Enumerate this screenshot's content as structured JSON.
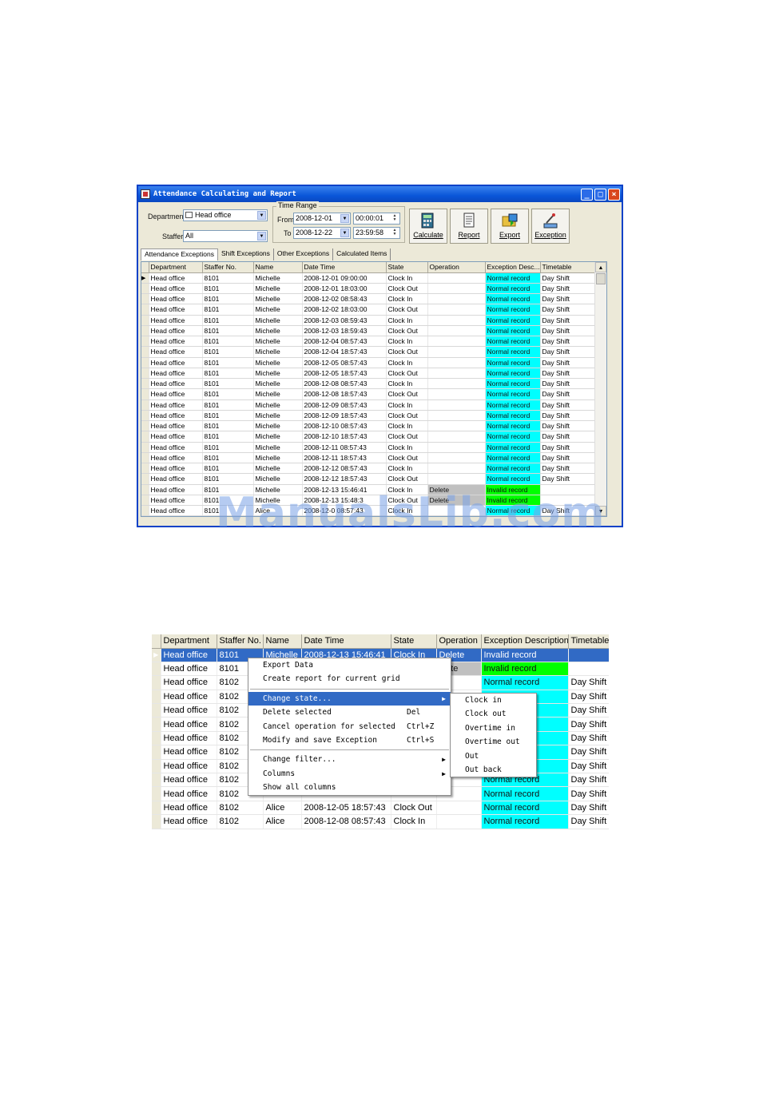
{
  "window": {
    "title": "Attendance Calculating and Report",
    "department_label": "Department",
    "department_value": "Head office",
    "staffer_label": "Staffer",
    "staffer_value": "All",
    "time_range_label": "Time Range",
    "from_label": "From",
    "from_date": "2008-12-01",
    "from_time": "00:00:01",
    "to_label": "To",
    "to_date": "2008-12-22",
    "to_time": "23:59:58",
    "buttons": [
      "Calculate",
      "Report",
      "Export",
      "Exception"
    ],
    "tabs": [
      "Attendance Exceptions",
      "Shift Exceptions",
      "Other Exceptions",
      "Calculated Items"
    ],
    "columns": [
      "Department",
      "Staffer No.",
      "Name",
      "Date Time",
      "State",
      "Operation",
      "Exception Desc...",
      "Timetable"
    ],
    "rows": [
      [
        "Head office",
        "8101",
        "Michelle",
        "2008-12-01 09:00:00",
        "Clock In",
        "",
        "Normal record",
        "Day Shift"
      ],
      [
        "Head office",
        "8101",
        "Michelle",
        "2008-12-01 18:03:00",
        "Clock Out",
        "",
        "Normal record",
        "Day Shift"
      ],
      [
        "Head office",
        "8101",
        "Michelle",
        "2008-12-02 08:58:43",
        "Clock In",
        "",
        "Normal record",
        "Day Shift"
      ],
      [
        "Head office",
        "8101",
        "Michelle",
        "2008-12-02 18:03:00",
        "Clock Out",
        "",
        "Normal record",
        "Day Shift"
      ],
      [
        "Head office",
        "8101",
        "Michelle",
        "2008-12-03 08:59:43",
        "Clock In",
        "",
        "Normal record",
        "Day Shift"
      ],
      [
        "Head office",
        "8101",
        "Michelle",
        "2008-12-03 18:59:43",
        "Clock Out",
        "",
        "Normal record",
        "Day Shift"
      ],
      [
        "Head office",
        "8101",
        "Michelle",
        "2008-12-04 08:57:43",
        "Clock In",
        "",
        "Normal record",
        "Day Shift"
      ],
      [
        "Head office",
        "8101",
        "Michelle",
        "2008-12-04 18:57:43",
        "Clock Out",
        "",
        "Normal record",
        "Day Shift"
      ],
      [
        "Head office",
        "8101",
        "Michelle",
        "2008-12-05 08:57:43",
        "Clock In",
        "",
        "Normal record",
        "Day Shift"
      ],
      [
        "Head office",
        "8101",
        "Michelle",
        "2008-12-05 18:57:43",
        "Clock Out",
        "",
        "Normal record",
        "Day Shift"
      ],
      [
        "Head office",
        "8101",
        "Michelle",
        "2008-12-08 08:57:43",
        "Clock In",
        "",
        "Normal record",
        "Day Shift"
      ],
      [
        "Head office",
        "8101",
        "Michelle",
        "2008-12-08 18:57:43",
        "Clock Out",
        "",
        "Normal record",
        "Day Shift"
      ],
      [
        "Head office",
        "8101",
        "Michelle",
        "2008-12-09 08:57:43",
        "Clock In",
        "",
        "Normal record",
        "Day Shift"
      ],
      [
        "Head office",
        "8101",
        "Michelle",
        "2008-12-09 18:57:43",
        "Clock Out",
        "",
        "Normal record",
        "Day Shift"
      ],
      [
        "Head office",
        "8101",
        "Michelle",
        "2008-12-10 08:57:43",
        "Clock In",
        "",
        "Normal record",
        "Day Shift"
      ],
      [
        "Head office",
        "8101",
        "Michelle",
        "2008-12-10 18:57:43",
        "Clock Out",
        "",
        "Normal record",
        "Day Shift"
      ],
      [
        "Head office",
        "8101",
        "Michelle",
        "2008-12-11 08:57:43",
        "Clock In",
        "",
        "Normal record",
        "Day Shift"
      ],
      [
        "Head office",
        "8101",
        "Michelle",
        "2008-12-11 18:57:43",
        "Clock Out",
        "",
        "Normal record",
        "Day Shift"
      ],
      [
        "Head office",
        "8101",
        "Michelle",
        "2008-12-12 08:57:43",
        "Clock In",
        "",
        "Normal record",
        "Day Shift"
      ],
      [
        "Head office",
        "8101",
        "Michelle",
        "2008-12-12 18:57:43",
        "Clock Out",
        "",
        "Normal record",
        "Day Shift"
      ],
      [
        "Head office",
        "8101",
        "Michelle",
        "2008-12-13 15:46:41",
        "Clock In",
        "Delete",
        "Invalid record",
        ""
      ],
      [
        "Head office",
        "8101",
        "Michelle",
        "2008-12-13 15:48:3",
        "Clock Out",
        "Delete",
        "Invalid record",
        ""
      ],
      [
        "Head office",
        "8101",
        "Alice",
        "2008-12-0 08:57:43",
        "Clock In",
        "",
        "Normal record",
        "Day Shift"
      ]
    ]
  },
  "watermark": "ManualsLib.com",
  "grid2": {
    "columns": [
      "Department",
      "Staffer No.",
      "Name",
      "Date Time",
      "State",
      "Operation",
      "Exception Description",
      "Timetable"
    ],
    "rows": [
      [
        "Head office",
        "8101",
        "Michelle",
        "2008-12-13 15:46:41",
        "Clock In",
        "Delete",
        "Invalid record",
        ""
      ],
      [
        "Head office",
        "8101",
        "",
        "",
        "",
        "elete",
        "Invalid record",
        ""
      ],
      [
        "Head office",
        "8102",
        "",
        "",
        "",
        "",
        "Normal record",
        "Day Shift"
      ],
      [
        "Head office",
        "8102",
        "",
        "",
        "",
        "",
        "",
        "Day Shift"
      ],
      [
        "Head office",
        "8102",
        "",
        "",
        "",
        "",
        "",
        "Day Shift"
      ],
      [
        "Head office",
        "8102",
        "",
        "",
        "",
        "",
        "",
        "Day Shift"
      ],
      [
        "Head office",
        "8102",
        "",
        "",
        "",
        "",
        "",
        "Day Shift"
      ],
      [
        "Head office",
        "8102",
        "",
        "",
        "",
        "",
        "",
        "Day Shift"
      ],
      [
        "Head office",
        "8102",
        "",
        "",
        "",
        "",
        "",
        "Day Shift"
      ],
      [
        "Head office",
        "8102",
        "",
        "",
        "",
        "",
        "Normal record",
        "Day Shift"
      ],
      [
        "Head office",
        "8102",
        "",
        "",
        "",
        "",
        "Normal record",
        "Day Shift"
      ],
      [
        "Head office",
        "8102",
        "Alice",
        "2008-12-05 18:57:43",
        "Clock Out",
        "",
        "Normal record",
        "Day Shift"
      ],
      [
        "Head office",
        "8102",
        "Alice",
        "2008-12-08 08:57:43",
        "Clock In",
        "",
        "Normal record",
        "Day Shift"
      ]
    ]
  },
  "context_menu": {
    "items": [
      {
        "label": "Export Data",
        "shortcut": ""
      },
      {
        "label": "Create report for current grid",
        "shortcut": ""
      },
      {
        "sep": true
      },
      {
        "label": "Change state...",
        "shortcut": "",
        "submenu": true,
        "highlight": true
      },
      {
        "label": "Delete selected",
        "shortcut": "Del"
      },
      {
        "label": "Cancel operation for selected",
        "shortcut": "Ctrl+Z"
      },
      {
        "label": "Modify and save Exception",
        "shortcut": "Ctrl+S"
      },
      {
        "sep": true
      },
      {
        "label": "Change filter...",
        "shortcut": "",
        "submenu": true
      },
      {
        "label": "Columns",
        "shortcut": "",
        "submenu": true
      },
      {
        "label": "Show all columns",
        "shortcut": ""
      }
    ],
    "submenu": [
      "Clock in",
      "Clock out",
      "Overtime in",
      "Overtime out",
      "Out",
      "Out back"
    ]
  },
  "colors": {
    "normal": "#00ffff",
    "invalid": "#00ff00",
    "selected": "#316ac5",
    "titlebar": "#0a56d8"
  }
}
